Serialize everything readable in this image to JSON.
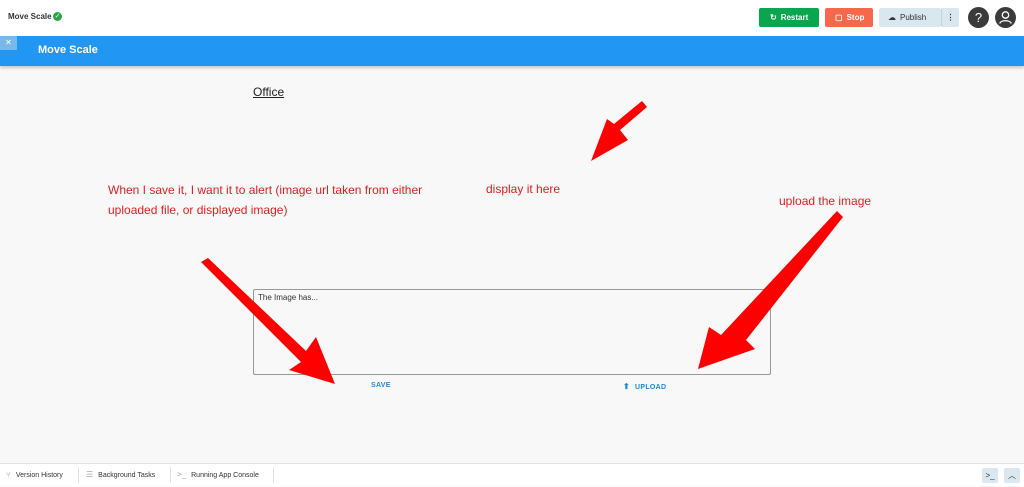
{
  "app": {
    "name": "Move Scale"
  },
  "toolbar": {
    "restart_label": "Restart",
    "stop_label": "Stop",
    "publish_label": "Publish"
  },
  "header": {
    "title": "Move Scale"
  },
  "main": {
    "heading": "Office",
    "textarea_value": "The Image has...",
    "save_label": "SAVE",
    "upload_label": "UPLOAD"
  },
  "annotations": {
    "save_note": "When I save it, I want it to alert (image url taken from either uploaded file, or displayed image)",
    "display_note": "display it here",
    "upload_note": "upload the image",
    "color": "#ff0000"
  },
  "bottom": {
    "tabs": [
      "Version History",
      "Background Tasks",
      "Running App Console"
    ]
  },
  "colors": {
    "accent": "#2196f3",
    "restart": "#0aa54f",
    "stop": "#f5684c"
  }
}
